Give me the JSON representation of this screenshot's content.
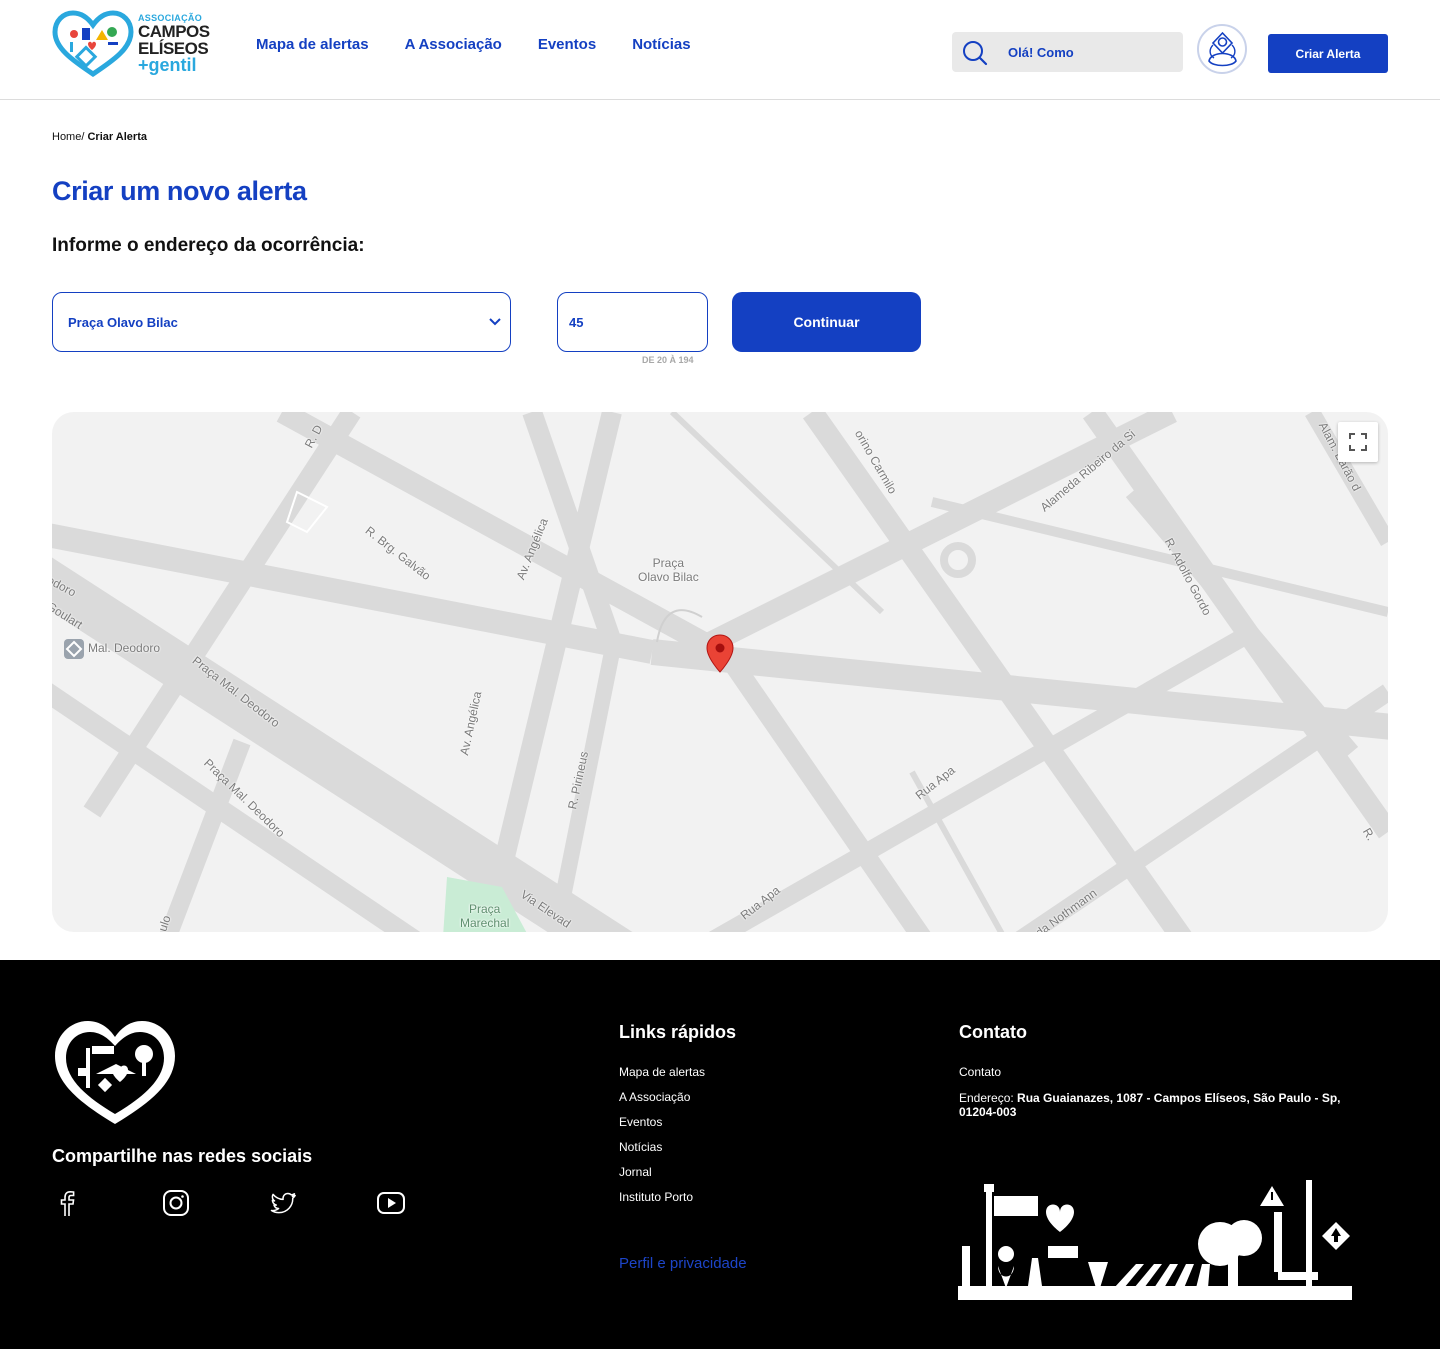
{
  "header": {
    "logo": {
      "line1": "ASSOCIAÇÃO",
      "line2": "CAMPOS",
      "line3": "ELÍSEOS",
      "line4": "+gentil"
    },
    "nav": [
      {
        "label": "Mapa de alertas"
      },
      {
        "label": "A Associação"
      },
      {
        "label": "Eventos"
      },
      {
        "label": "Notícias"
      }
    ],
    "search": {
      "value": "Olá! Como"
    },
    "cta_label": "Criar Alerta"
  },
  "breadcrumb": {
    "home": "Home",
    "separator": "/ ",
    "current": "Criar Alerta"
  },
  "form": {
    "title": "Criar um novo alerta",
    "subtitle": "Informe o endereço da ocorrência:",
    "street": {
      "selected": "Praça Olavo Bilac"
    },
    "number": {
      "value": "45",
      "hint": "DE 20 À 194"
    },
    "continue_label": "Continuar"
  },
  "map": {
    "labels": {
      "r_d": "R. D",
      "brg_galvao": "R. Brg. Galvão",
      "angelica_top": "Av. Angélica",
      "angelica_bottom": "Av. Angélica",
      "praca_olavo_bilac": [
        "Praça",
        "Olavo Bilac"
      ],
      "carmilo": "orino Carmilo",
      "ribeiro": "Alameda Ribeiro da Si",
      "barao": "Alam. Barão d",
      "adolfo_gordo": "R. Adolfo Gordo",
      "deodoro_left": "odoro",
      "goulart": "Goulart",
      "mal_deodoro_station": "Mal. Deodoro",
      "praca_mal_deodoro_1": "Praça Mal. Deodoro",
      "praca_mal_deodoro_2": "Praça Mal. Deodoro",
      "pirineus": "R. Pirineus",
      "rua_apa_1": "Rua Apa",
      "rua_apa_2": "Rua Apa",
      "nothmann": "da Nothmann",
      "via_elevado": "Via Elevad",
      "praca_marechal": [
        "Praça",
        "Marechal"
      ],
      "r_edge": "R.",
      "ulo": "ulo"
    },
    "marker": {
      "color": "#ea4335"
    }
  },
  "footer": {
    "share_title": "Compartilhe nas redes sociais",
    "social": [
      {
        "name": "facebook-icon"
      },
      {
        "name": "instagram-icon"
      },
      {
        "name": "twitter-icon"
      },
      {
        "name": "youtube-icon"
      }
    ],
    "quick_links_title": "Links rápidos",
    "quick_links": [
      {
        "label": "Mapa de alertas"
      },
      {
        "label": "A Associação"
      },
      {
        "label": "Eventos"
      },
      {
        "label": "Notícias"
      },
      {
        "label": "Jornal"
      },
      {
        "label": "Instituto Porto"
      }
    ],
    "privacy_label": "Perfil e privacidade",
    "contact_title": "Contato",
    "contact_label": "Contato",
    "address_label": "Endereço: ",
    "address_value": "Rua Guaianazes, 1087 - Campos Elíseos, São Paulo - Sp, 01204-003"
  },
  "colors": {
    "primary": "#1440c2",
    "accent": "#2aa8de",
    "footer_bg": "#000000",
    "map_bg": "#f2f2f2"
  }
}
